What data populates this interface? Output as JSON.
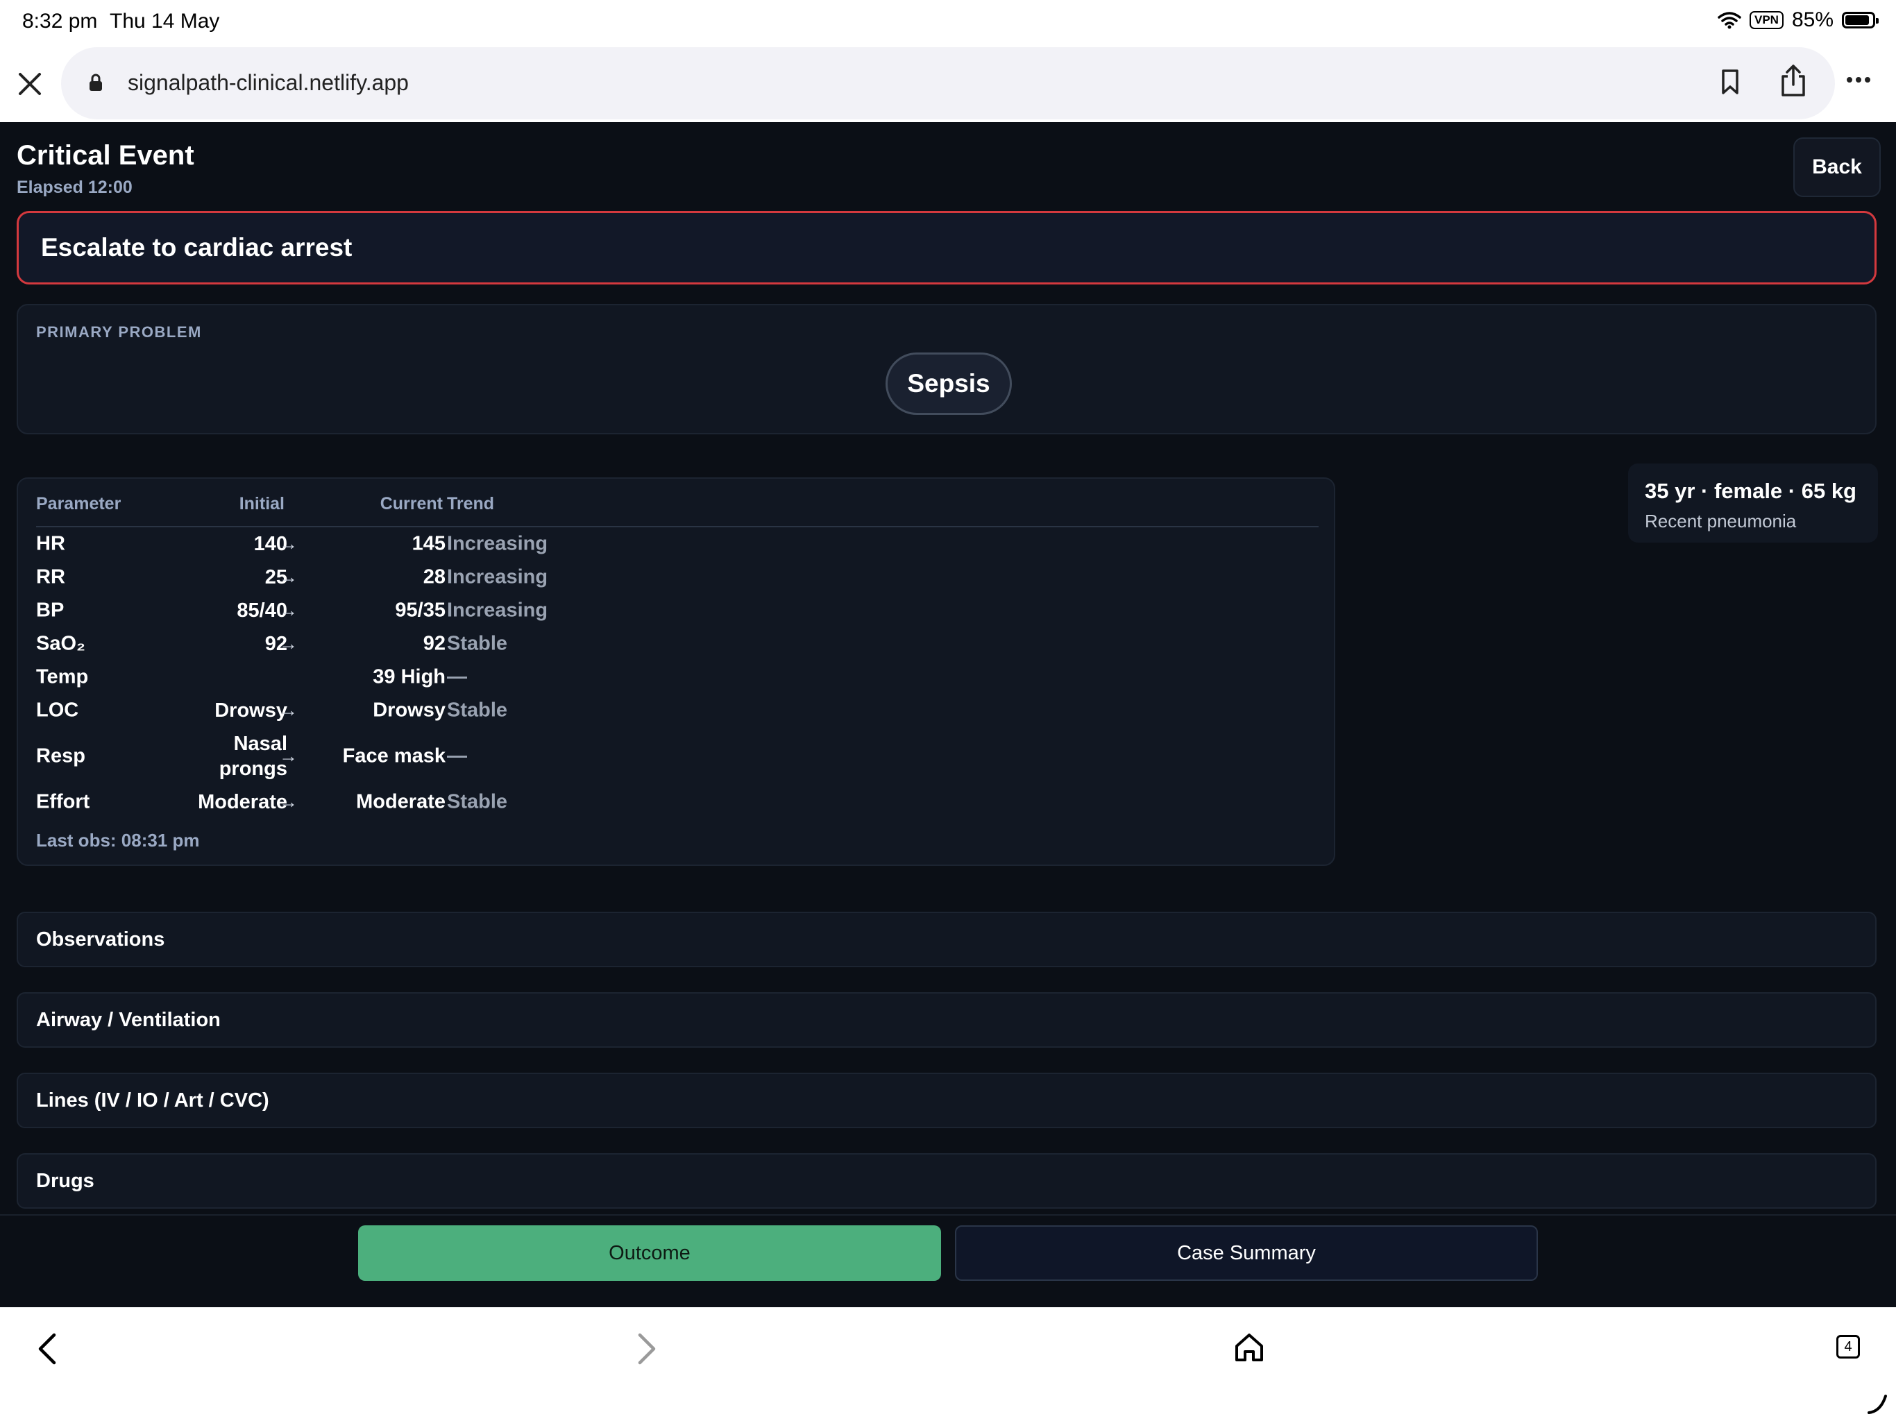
{
  "status_bar": {
    "time": "8:32 pm",
    "date": "Thu 14 May",
    "vpn": "VPN",
    "battery": "85%"
  },
  "browser": {
    "url": "signalpath-clinical.netlify.app",
    "tab_count": "4"
  },
  "header": {
    "title": "Critical Event",
    "elapsed": "Elapsed 12:00",
    "back_label": "Back"
  },
  "alert": {
    "text": "Escalate to cardiac arrest",
    "border_color": "#d4393e"
  },
  "primary_problem": {
    "label": "PRIMARY PROBLEM",
    "value": "Sepsis"
  },
  "vitals": {
    "headers": {
      "parameter": "Parameter",
      "initial": "Initial",
      "current": "Current",
      "trend": "Trend"
    },
    "rows": [
      {
        "param": "HR",
        "initial": "140",
        "current": "145",
        "trend": "Increasing"
      },
      {
        "param": "RR",
        "initial": "25",
        "current": "28",
        "trend": "Increasing"
      },
      {
        "param": "BP",
        "initial": "85/40",
        "current": "95/35",
        "trend": "Increasing"
      },
      {
        "param": "SaO₂",
        "initial": "92",
        "current": "92",
        "trend": "Stable"
      },
      {
        "param": "Temp",
        "initial": "",
        "current": "39 High",
        "trend": "—"
      },
      {
        "param": "LOC",
        "initial": "Drowsy",
        "current": "Drowsy",
        "trend": "Stable"
      },
      {
        "param": "Resp",
        "initial": "Nasal\nprongs",
        "current": "Face mask",
        "trend": "—"
      },
      {
        "param": "Effort",
        "initial": "Moderate",
        "current": "Moderate",
        "trend": "Stable"
      }
    ],
    "last_obs": "Last obs: 08:31 pm"
  },
  "patient": {
    "summary": "35 yr · female · 65 kg",
    "history": "Recent pneumonia"
  },
  "sections": [
    "Observations",
    "Airway / Ventilation",
    "Lines (IV / IO / Art / CVC)",
    "Drugs"
  ],
  "actions": {
    "outcome": "Outcome",
    "case_summary": "Case Summary",
    "outcome_color": "#4caf7d"
  }
}
